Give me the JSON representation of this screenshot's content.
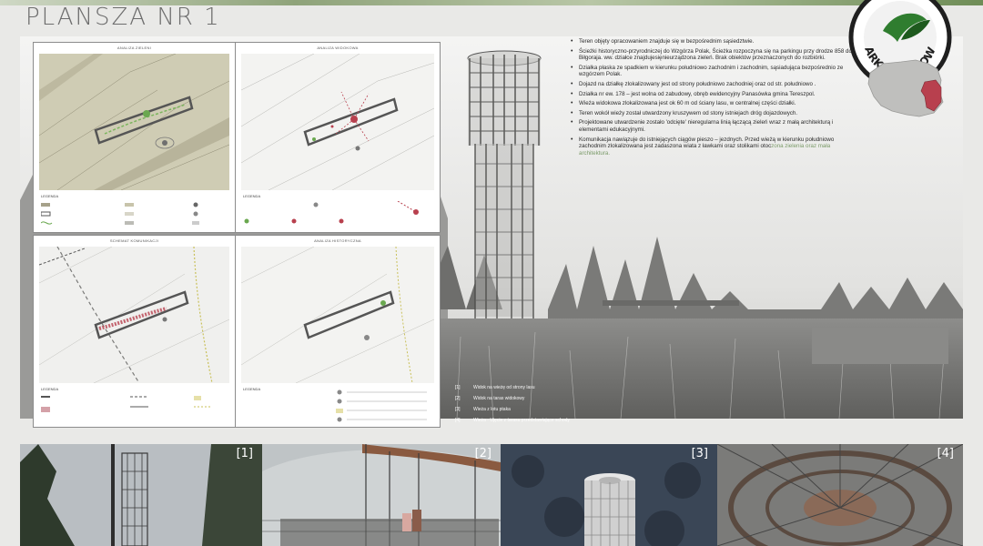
{
  "sheet": {
    "title": "PLANSZA NR 1"
  },
  "logo": {
    "text": "PARK NARODOWY",
    "colors": {
      "ring": "#1f1f1f",
      "leaf": "#2f7d2f"
    }
  },
  "panels": [
    {
      "title": "ANALIZA ZIELENI",
      "legend_title": "LEGENDA"
    },
    {
      "title": "ANALIZA WIDOKOWA",
      "legend_title": "LEGENDA"
    },
    {
      "title": "SCHEMAT KOMUNIKACJI",
      "legend_title": "LEGENDA"
    },
    {
      "title": "ANALIZA HISTORYCZNA",
      "legend_title": "LEGENDA"
    }
  ],
  "description": [
    {
      "text": "Teren objęty opracowaniem znajduje się w bezpośrednim sąsiedztwie."
    },
    {
      "text": "Ścieżki historyczno-przyrodniczej do Wzgórza Polak, Ścieżka rozpoczyna się na parkingu przy drodze 858 do Biłgoraja. ww. działce znajdujesięnieurządzona zieleń. Brak obiektów przeznaczonych do rozbiórki."
    },
    {
      "text": "Działka płaska ze spadkiem w kierunku południowo zachodnim i zachodnim, sąsiadująca bezpośrednio ze wzgórzem Polak."
    },
    {
      "text": "Dojazd na działkę zlokalizowany jest od strony południowo zachodniej oraz od str. południowo ."
    },
    {
      "text": "Działka nr ew. 178 – jest wolna od zabudowy, obręb ewidencyjny Panasówka gmina Tereszpol."
    },
    {
      "text": "Wieża widokowa zlokalizowana jest ok 60 m od ściany lasu, w centralnej części działki."
    },
    {
      "text": "Teren wokół wieży został utwardzony kruszywem od stony istniejach dróg dojazdowych."
    },
    {
      "text": "Projektowane utwardzenie zostało 'odcięte' nieregularna linią łączącą zieleń wraz z małą architekturą i elementami edukacyjnymi."
    },
    {
      "text": "Komunikacja nawiązuje do istniejących ciągów pieszo – jezdnych. Przed wieżą w kierunku południowo zachodnim zlokalizowana jest zadaszona wiata z ławkami oraz stolikami otoc",
      "green": "zona zieleniа oraz mała architektura."
    }
  ],
  "captions": [
    {
      "num": "[1]",
      "text": "Widok na wieżę od strony lasu"
    },
    {
      "num": "[2]",
      "text": "Widok na taras widokowy"
    },
    {
      "num": "[3]",
      "text": "Wieża z lotu ptaka"
    },
    {
      "num": "[4]",
      "text": "Wieża - Ujęcie z tarasu przedstawiające schody"
    }
  ],
  "thumbnails": [
    {
      "label": "[1]"
    },
    {
      "label": "[2]"
    },
    {
      "label": "[3]"
    },
    {
      "label": "[4]"
    }
  ],
  "colors": {
    "accent_red": "#b8404e",
    "map_green": "#6aa84f",
    "map_beige": "#cfccb4"
  }
}
